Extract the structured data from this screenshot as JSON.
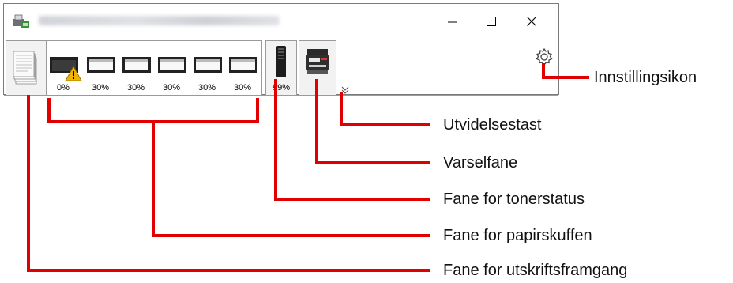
{
  "window": {
    "title_icon": "printer-monitor-icon",
    "controls": [
      "minimize-icon",
      "maximize-icon",
      "close-icon"
    ]
  },
  "tabs": {
    "progress": {
      "icon": "document-stack-icon"
    },
    "paper": {
      "cassettes": [
        {
          "percent": "0%",
          "warning": true
        },
        {
          "percent": "30%",
          "warning": false
        },
        {
          "percent": "30%",
          "warning": false
        },
        {
          "percent": "30%",
          "warning": false
        },
        {
          "percent": "30%",
          "warning": false
        },
        {
          "percent": "30%",
          "warning": false
        }
      ]
    },
    "toner": {
      "percent": "99%",
      "icon": "toner-cartridge-icon"
    },
    "alert": {
      "icon": "multifunction-printer-icon"
    }
  },
  "expand_icon": "double-chevron-down-icon",
  "settings_icon": "gear-icon",
  "colors": {
    "callout": "#e00000",
    "warning": "#f2b400"
  },
  "callouts": {
    "settings": "Innstillingsikon",
    "expand": "Utvidelsestast",
    "alert": "Varselfane",
    "toner": "Fane for tonerstatus",
    "paper": "Fane for papirskuffen",
    "progress": "Fane for utskriftsframgang"
  }
}
